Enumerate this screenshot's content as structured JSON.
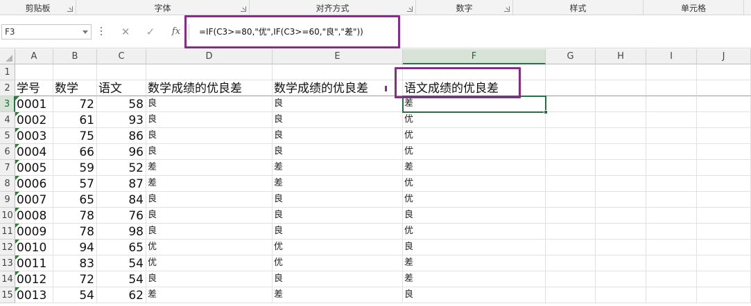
{
  "ribbon": {
    "groups": [
      {
        "label": "剪贴板",
        "launcher": true
      },
      {
        "label": "字体",
        "launcher": true
      },
      {
        "label": "对齐方式",
        "launcher": true
      },
      {
        "label": "数字",
        "launcher": true
      },
      {
        "label": "样式",
        "launcher": false
      },
      {
        "label": "单元格",
        "launcher": false
      }
    ]
  },
  "formula_bar": {
    "name_box": "F3",
    "cancel_icon": "✕",
    "enter_icon": "✓",
    "fx_label": "fx",
    "formula": "=IF(C3>=80,\"优\",IF(C3>=60,\"良\",\"差\"))"
  },
  "grid": {
    "columns": [
      "A",
      "B",
      "C",
      "D",
      "E",
      "F",
      "G",
      "H",
      "I",
      "J"
    ],
    "active_column": "F",
    "active_row": "3",
    "row_numbers": [
      "1",
      "2",
      "3",
      "4",
      "5",
      "6",
      "7",
      "8",
      "9",
      "10",
      "11",
      "12",
      "13",
      "14",
      "15"
    ],
    "header_row": [
      "学号",
      "数学",
      "语文",
      "数学成绩的优良差",
      "数学成绩的优良差",
      "语文成绩的优良差"
    ],
    "rows": [
      [
        "0001",
        "72",
        "58",
        "良",
        "良",
        "差"
      ],
      [
        "0002",
        "61",
        "93",
        "良",
        "良",
        "优"
      ],
      [
        "0003",
        "75",
        "86",
        "良",
        "良",
        "优"
      ],
      [
        "0004",
        "66",
        "96",
        "良",
        "良",
        "优"
      ],
      [
        "0005",
        "59",
        "52",
        "差",
        "差",
        "差"
      ],
      [
        "0006",
        "57",
        "87",
        "差",
        "差",
        "优"
      ],
      [
        "0007",
        "65",
        "84",
        "良",
        "良",
        "优"
      ],
      [
        "0008",
        "78",
        "76",
        "良",
        "良",
        "良"
      ],
      [
        "0009",
        "78",
        "98",
        "良",
        "良",
        "优"
      ],
      [
        "0010",
        "94",
        "65",
        "优",
        "优",
        "良"
      ],
      [
        "0011",
        "83",
        "54",
        "优",
        "优",
        "差"
      ],
      [
        "0012",
        "72",
        "54",
        "良",
        "良",
        "差"
      ],
      [
        "0013",
        "54",
        "62",
        "差",
        "差",
        "良"
      ]
    ]
  },
  "colors": {
    "accent_green": "#217346",
    "highlight_purple": "#8a2a8a"
  }
}
